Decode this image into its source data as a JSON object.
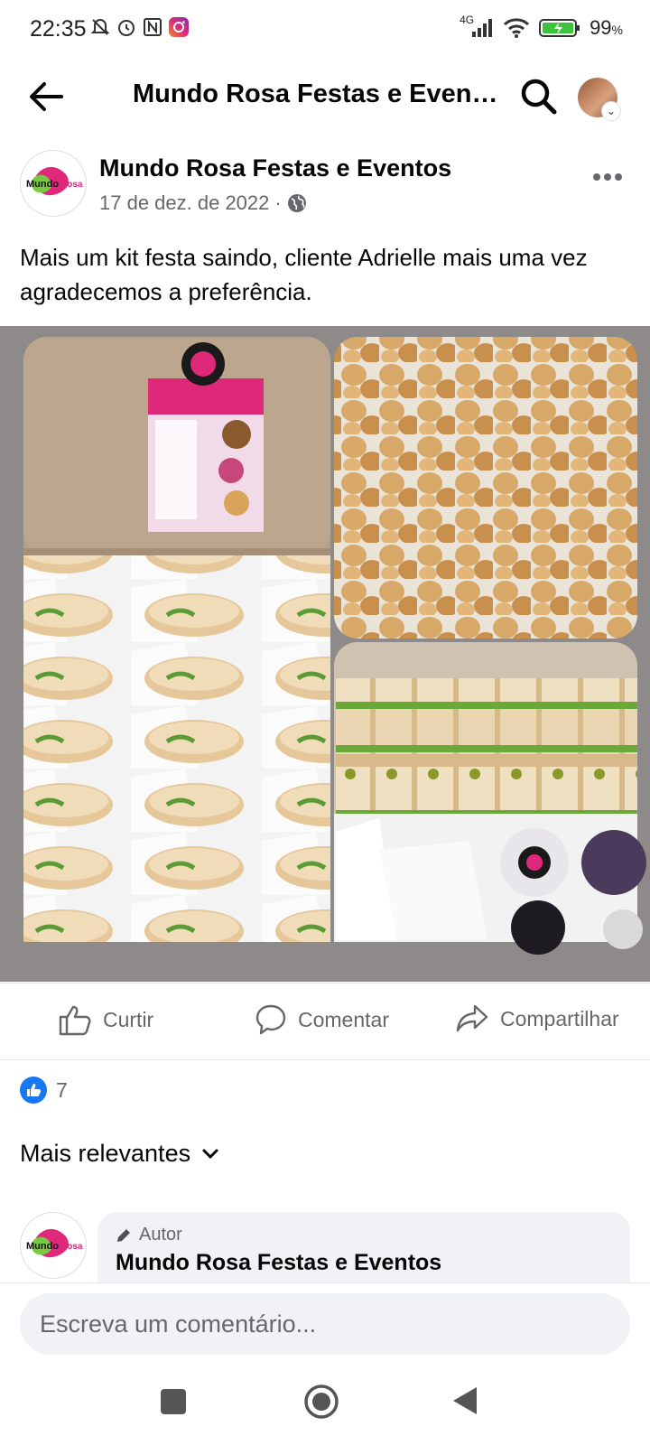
{
  "status_bar": {
    "time": "22:35",
    "network": "4G",
    "battery": "99",
    "battery_unit": "%",
    "icons": [
      "mute-icon",
      "alarm-icon",
      "nfc-icon",
      "instagram-icon",
      "signal-icon",
      "wifi-icon",
      "battery-icon"
    ]
  },
  "header": {
    "title": "Mundo Rosa Festas e Eventos"
  },
  "post": {
    "author": "Mundo Rosa Festas e Eventos",
    "date": "17 de dez. de 2022",
    "separator": "·",
    "text": "Mais um kit festa saindo, cliente Adrielle mais uma vez agradecemos a preferência.",
    "logo_text": "Mundo Rosa"
  },
  "actions": {
    "like": "Curtir",
    "comment": "Comentar",
    "share": "Compartilhar"
  },
  "reactions": {
    "count": "7"
  },
  "comments": {
    "sort_label": "Mais relevantes",
    "items": [
      {
        "badge": "Autor",
        "author": "Mundo Rosa Festas e Eventos"
      }
    ]
  },
  "composer": {
    "placeholder": "Escreva um comentário..."
  },
  "colors": {
    "brand_blue": "#1877f2",
    "secondary_text": "#65676b",
    "bubble_bg": "#f0f2f5",
    "logo_pink": "#e0287a"
  }
}
